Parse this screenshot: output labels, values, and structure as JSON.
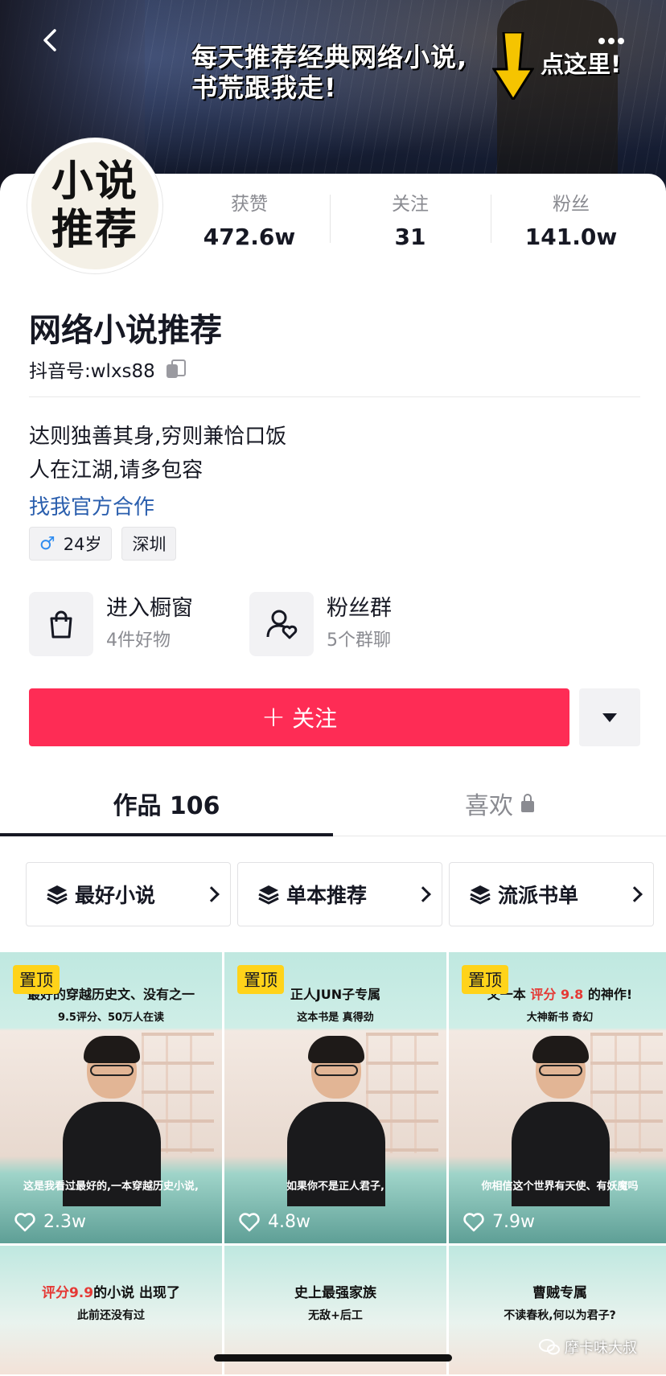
{
  "banner": {
    "line1": "每天推荐经典网络小说,",
    "line2": "书荒跟我走!",
    "cta": "点这里!"
  },
  "avatar": {
    "line1": "小说",
    "line2": "推荐"
  },
  "stats": [
    {
      "label": "获赞",
      "value": "472.6w"
    },
    {
      "label": "关注",
      "value": "31"
    },
    {
      "label": "粉丝",
      "value": "141.0w"
    }
  ],
  "profile": {
    "name": "网络小说推荐",
    "id_label": "抖音号:wlxs88",
    "bio_line1": "达则独善其身,穷则兼恰口饭",
    "bio_line2": "人在江湖,请多包容",
    "link": "找我官方合作",
    "gender_symbol": "♂",
    "age": "24岁",
    "location": "深圳"
  },
  "entries": [
    {
      "title": "进入橱窗",
      "sub": "4件好物",
      "icon": "shopping-bag-icon"
    },
    {
      "title": "粉丝群",
      "sub": "5个群聊",
      "icon": "fan-group-icon"
    }
  ],
  "follow": {
    "label": "关注"
  },
  "tabs": [
    {
      "label": "作品 106"
    },
    {
      "label": "喜欢"
    }
  ],
  "collections": [
    {
      "label": "最好小说"
    },
    {
      "label": "单本推荐"
    },
    {
      "label": "流派书单"
    }
  ],
  "videos": [
    {
      "pinned": "置顶",
      "title": "最好的穿越历史文、没有之一",
      "sub": "9.5评分、50万人在读",
      "caption": "这是我看过最好的,一本穿越历史小说,",
      "likes": "2.3w"
    },
    {
      "pinned": "置顶",
      "title": "正人JUN子专属",
      "sub": "这本书是 真得劲",
      "caption": "如果你不是正人君子,",
      "likes": "4.8w"
    },
    {
      "pinned": "置顶",
      "title_pre": "又一本",
      "title_hl": "评分 9.8",
      "title_post": "的神作!",
      "sub": "大神新书 奇幻",
      "caption": "你相信这个世界有天使、有妖魔吗",
      "likes": "7.9w"
    },
    {
      "title_hl": "评分9.9",
      "title_post": "的小说 出现了",
      "sub": "此前还没有过"
    },
    {
      "title": "史上最强家族",
      "sub": "无敌+后工"
    },
    {
      "title": "曹贼专属",
      "sub": "不读春秋,何以为君子?"
    }
  ],
  "watermark": "摩卡味大叔",
  "colors": {
    "accent": "#fe2c55",
    "link": "#2b5fae",
    "pin_badge": "#ffd31a",
    "gender": "#2f8cf0"
  }
}
